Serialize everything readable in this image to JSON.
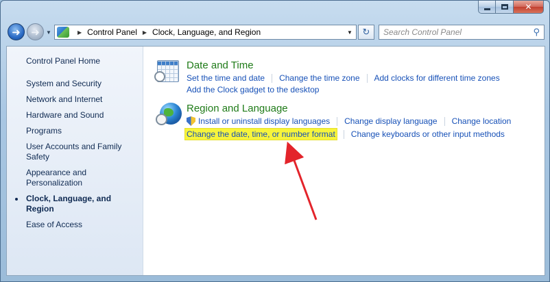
{
  "window": {
    "controls": {
      "minimize": "minimize",
      "maximize": "maximize",
      "close": "✕"
    }
  },
  "nav": {
    "back_icon": "back-arrow-icon",
    "forward_icon": "forward-arrow-icon",
    "address": {
      "root": "Control Panel",
      "current": "Clock, Language, and Region"
    },
    "search_placeholder": "Search Control Panel"
  },
  "sidebar": {
    "home": "Control Panel Home",
    "items": [
      {
        "label": "System and Security"
      },
      {
        "label": "Network and Internet"
      },
      {
        "label": "Hardware and Sound"
      },
      {
        "label": "Programs"
      },
      {
        "label": "User Accounts and Family Safety"
      },
      {
        "label": "Appearance and Personalization"
      },
      {
        "label": "Clock, Language, and Region",
        "current": true
      },
      {
        "label": "Ease of Access"
      }
    ]
  },
  "categories": {
    "date_time": {
      "title": "Date and Time",
      "links": [
        "Set the time and date",
        "Change the time zone",
        "Add clocks for different time zones"
      ],
      "links2": [
        "Add the Clock gadget to the desktop"
      ]
    },
    "region_language": {
      "title": "Region and Language",
      "links": [
        "Install or uninstall display languages",
        "Change display language",
        "Change location"
      ],
      "links2": [
        "Change the date, time, or number format",
        "Change keyboards or other input methods"
      ]
    }
  },
  "colors": {
    "highlight": "#f7f43a",
    "arrow": "#e3242b",
    "link": "#1650b7",
    "category_title": "#1f7b18"
  }
}
